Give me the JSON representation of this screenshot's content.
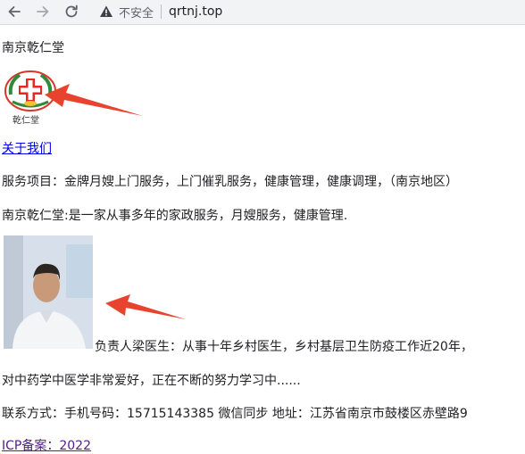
{
  "browser": {
    "url": "qrtnj.top",
    "security_label": "不安全"
  },
  "page": {
    "site_title": "南京乾仁堂",
    "logo_text": "乾仁堂",
    "about_link": "关于我们",
    "services": "服务项目：金牌月嫂上门服务，上门催乳服务，健康管理，健康调理，（南京地区）",
    "intro": "南京乾仁堂:是一家从事多年的家政服务，月嫂服务，健康管理.",
    "person_line1": "负责人梁医生：从事十年乡村医生，乡村基层卫生防疫工作近20年，",
    "person_line2": "对中药学中医学非常爱好，正在不断的努力学习中......",
    "contact": "联系方式：手机号码：15715143385 微信同步 地址：江苏省南京市鼓楼区赤壁路9",
    "icp_link": "ICP备案：2022"
  },
  "colors": {
    "link": "#0000ee",
    "visited_link": "#551a8b",
    "arrow": "#e8432e"
  }
}
